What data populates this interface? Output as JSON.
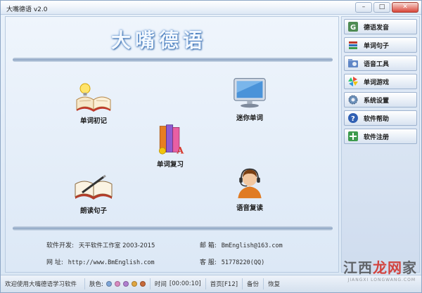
{
  "window": {
    "title": "大嘴德语 v2.0",
    "controls": {
      "minimize": "–",
      "maximize": "□",
      "close": "✕"
    }
  },
  "main": {
    "app_title": "大嘴德语",
    "features": [
      {
        "label": "单词初记",
        "icon": "open-book-lightbulb-icon"
      },
      {
        "label": "迷你单词",
        "icon": "computer-monitor-icon"
      },
      {
        "label": "单词复习",
        "icon": "stacked-books-icon"
      },
      {
        "label": "朗读句子",
        "icon": "book-pen-icon"
      },
      {
        "label": "语音复读",
        "icon": "headset-operator-icon"
      }
    ],
    "info": {
      "developer_label": "软件开发:",
      "developer_value": "天平软件工作室 2003-2015",
      "email_label": "邮   箱:",
      "email_value": "BmEnglish@163.com",
      "site_label": "网   址:",
      "site_value": "http://www.BmEnglish.com",
      "service_label": "客   服:",
      "service_value": "51778220(QQ)"
    }
  },
  "sidebar": {
    "items": [
      {
        "label": "德语发音",
        "icon": "g-letter-icon"
      },
      {
        "label": "单词句子",
        "icon": "book-stack-icon"
      },
      {
        "label": "语音工具",
        "icon": "folder-tools-icon"
      },
      {
        "label": "单词游戏",
        "icon": "colorful-pinwheel-icon"
      },
      {
        "label": "系统设置",
        "icon": "gear-icon"
      },
      {
        "label": "软件帮助",
        "icon": "help-question-icon"
      },
      {
        "label": "软件注册",
        "icon": "register-plus-icon"
      }
    ]
  },
  "statusbar": {
    "welcome": "欢迎使用大嘴德语学习软件",
    "skin_label": "肤色:",
    "skin_colors": [
      "#7fa6d8",
      "#d88ac0",
      "#b07fd0",
      "#e0a640",
      "#c76a3a"
    ],
    "time_label": "时间",
    "time_value": "[00:00:10]",
    "home_label": "首页[F12]",
    "backup_label": "备份",
    "restore_label": "恢复"
  },
  "watermark": {
    "text_main": "江西",
    "text_red": "龙网",
    "text_end": "家",
    "sub": "JIANGXI LONGWANG.COM"
  }
}
